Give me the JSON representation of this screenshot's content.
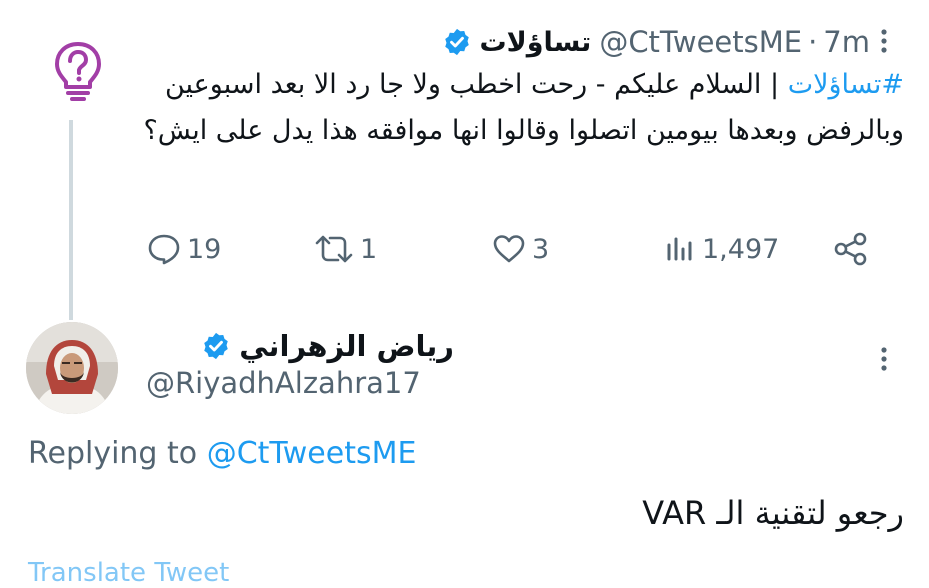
{
  "parent_tweet": {
    "avatar_icon": "question-bulb-icon",
    "display_name": "تساؤلات",
    "handle": "@CtTweetsME",
    "separator": "·",
    "time": "7m",
    "hashtag": "#تساؤلات",
    "text": " | السلام عليكم - رحت اخطب ولا جا رد الا بعد اسبوعين وبالرفض وبعدها بيومين اتصلوا وقالوا انها موافقه هذا يدل على ايش؟",
    "replies": "19",
    "retweets": "1",
    "likes": "3",
    "views": "1,497"
  },
  "reply_tweet": {
    "display_name": "رياض الزهراني",
    "handle": "@RiyadhAlzahra17",
    "replying_prefix": "Replying to",
    "replying_handle": "@CtTweetsME",
    "text": "رجعو لتقنية الـ VAR",
    "translate_label": "Translate Tweet"
  },
  "colors": {
    "accent": "#1d9bf0",
    "secondary_text": "#536471",
    "avatar_icon": "#a23ea6",
    "thread_line": "#cfd9de"
  }
}
